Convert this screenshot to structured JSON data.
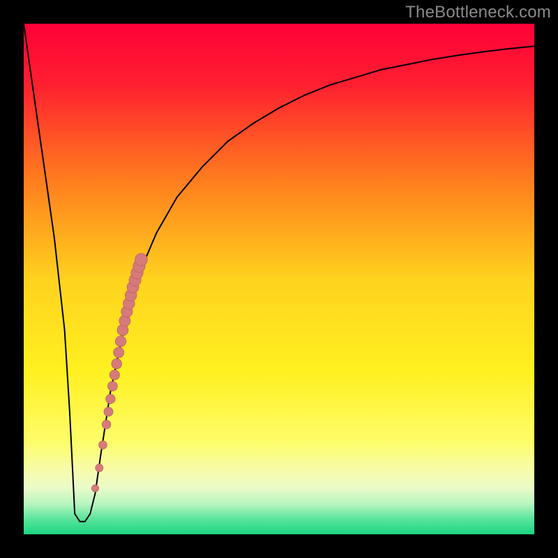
{
  "watermark": "TheBottleneck.com",
  "colors": {
    "gradient": [
      {
        "offset": "0%",
        "color": "#ff0038"
      },
      {
        "offset": "12%",
        "color": "#ff2030"
      },
      {
        "offset": "30%",
        "color": "#ff7a1e"
      },
      {
        "offset": "50%",
        "color": "#ffd21e"
      },
      {
        "offset": "68%",
        "color": "#fff020"
      },
      {
        "offset": "82%",
        "color": "#fdfd6a"
      },
      {
        "offset": "88%",
        "color": "#f6fbb0"
      },
      {
        "offset": "91%",
        "color": "#e8fbc8"
      },
      {
        "offset": "94%",
        "color": "#b9f5c0"
      },
      {
        "offset": "97%",
        "color": "#5ae49c"
      },
      {
        "offset": "100%",
        "color": "#1bd580"
      }
    ],
    "curve": "#000000",
    "dot_fill": "#d67a7a",
    "dot_stroke": "#b05858"
  },
  "chart_data": {
    "type": "line",
    "title": "",
    "xlabel": "",
    "ylabel": "",
    "xlim": [
      0,
      100
    ],
    "ylim": [
      0,
      100
    ],
    "grid": false,
    "series": [
      {
        "name": "bottleneck-curve",
        "x": [
          0,
          2,
          4,
          6,
          8,
          9,
          10,
          11,
          12,
          13,
          14,
          15,
          17,
          20,
          23,
          26,
          30,
          35,
          40,
          45,
          50,
          55,
          60,
          65,
          70,
          75,
          80,
          85,
          90,
          95,
          100
        ],
        "y": [
          100,
          86,
          72,
          58,
          40,
          24,
          4,
          2.5,
          2.5,
          4,
          8,
          15,
          28,
          42,
          52,
          59,
          66,
          72,
          77,
          80.5,
          83.5,
          86,
          88,
          89.5,
          91,
          92,
          93,
          93.8,
          94.5,
          95.1,
          95.6
        ]
      }
    ],
    "points": {
      "name": "highlighted-data-points",
      "x": [
        14.0,
        14.8,
        15.5,
        16.2,
        16.6,
        17.0,
        17.4,
        17.8,
        18.2,
        18.6,
        19.0,
        19.4,
        19.8,
        20.2,
        20.6,
        21.0,
        21.4,
        21.8,
        22.2,
        22.6,
        23.0
      ],
      "y": [
        9.0,
        13.0,
        17.5,
        21.5,
        24.0,
        26.5,
        29.0,
        31.2,
        33.4,
        35.6,
        37.8,
        40.0,
        41.8,
        43.6,
        45.2,
        46.8,
        48.4,
        49.8,
        51.2,
        52.5,
        53.8
      ],
      "r": [
        5.2,
        5.6,
        6.0,
        6.3,
        6.6,
        6.8,
        7.0,
        7.2,
        7.4,
        7.6,
        7.8,
        8.0,
        8.1,
        8.2,
        8.3,
        8.4,
        8.5,
        8.6,
        8.7,
        8.8,
        8.9
      ]
    }
  }
}
